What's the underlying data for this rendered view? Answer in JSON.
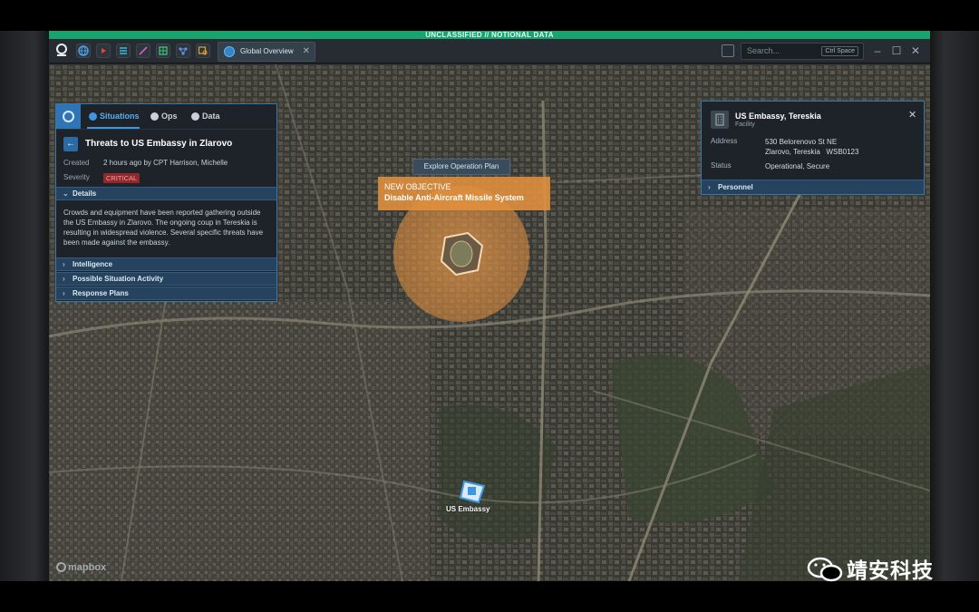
{
  "classification_banner": "UNCLASSIFIED // NOTIONAL DATA",
  "toolbar": {
    "icons": [
      "app-logo-icon",
      "globe-icon",
      "video-icon",
      "layers-icon",
      "graph-icon",
      "table-icon",
      "network-icon",
      "map-search-icon"
    ],
    "tab_label": "Global Overview",
    "search_placeholder": "Search...",
    "search_shortcut": "Ctrl Space"
  },
  "situation_panel": {
    "tabs": [
      {
        "label": "Situations",
        "active": true
      },
      {
        "label": "Ops",
        "active": false
      },
      {
        "label": "Data",
        "active": false
      }
    ],
    "title": "Threats to US Embassy in Zlarovo",
    "created_label": "Created",
    "created_value": "2 hours ago by CPT Harrison, Michelle",
    "severity_label": "Severity",
    "severity_value": "CRITICAL",
    "details_header": "Details",
    "details_text": "Crowds and equipment have been reported gathering outside the US Embassy in Zlarovo. The ongoing coup in Tereskia is resulting in widespread violence. Several specific threats have been made against the embassy.",
    "sections": [
      "Intelligence",
      "Possible Situation Activity",
      "Response Plans"
    ]
  },
  "map": {
    "tooltip": "Explore Operation Plan",
    "objective_line1": "NEW OBJECTIVE",
    "objective_line2": "Disable Anti-Aircraft Missile System",
    "embassy_label": "US Embassy",
    "attribution": "mapbox"
  },
  "facility_panel": {
    "title": "US Embassy, Tereskia",
    "subtitle": "Facility",
    "address_label": "Address",
    "address_line1": "530 Belorenovo St NE",
    "address_line2": "Zlarovo, Tereskia   WSB0123",
    "status_label": "Status",
    "status_value": "Operational, Secure",
    "section": "Personnel"
  },
  "watermark": "靖安科技",
  "colors": {
    "accent": "#3e95e0",
    "classification": "#18a36f",
    "objective": "#e2913e",
    "critical": "#8f2a2c"
  }
}
